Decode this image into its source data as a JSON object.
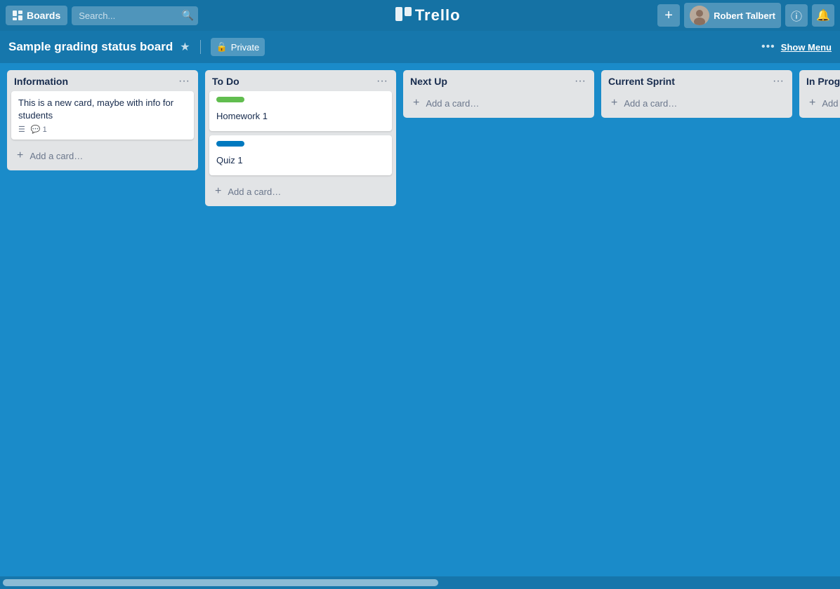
{
  "topNav": {
    "boards_label": "Boards",
    "search_placeholder": "Search...",
    "trello_label": "Trello",
    "add_button_label": "+",
    "user_name": "Robert Talbert",
    "info_icon": "ℹ",
    "notif_icon": "🔔"
  },
  "boardHeader": {
    "title": "Sample grading status board",
    "star_icon": "★",
    "privacy_icon": "🔒",
    "privacy_label": "Private",
    "show_menu_dots": "•••",
    "show_menu_label": "Show Menu"
  },
  "lists": [
    {
      "id": "information",
      "title": "Information",
      "menu_icon": "•••",
      "cards": [
        {
          "id": "card-info-1",
          "title": "This is a new card, maybe with info for students",
          "label": null,
          "has_description": true,
          "comment_count": "1"
        }
      ],
      "add_card_label": "Add a card…"
    },
    {
      "id": "to-do",
      "title": "To Do",
      "menu_icon": "•••",
      "cards": [
        {
          "id": "card-todo-1",
          "title": "Homework 1",
          "label": "green",
          "has_description": false,
          "comment_count": null
        },
        {
          "id": "card-todo-2",
          "title": "Quiz 1",
          "label": "blue",
          "has_description": false,
          "comment_count": null
        }
      ],
      "add_card_label": "Add a card…"
    },
    {
      "id": "next-up",
      "title": "Next Up",
      "menu_icon": "•••",
      "cards": [],
      "add_card_label": "Add a card…"
    },
    {
      "id": "current-sprint",
      "title": "Current Sprint",
      "menu_icon": "•••",
      "cards": [],
      "add_card_label": "Add a card…"
    },
    {
      "id": "in-progress",
      "title": "In Progress",
      "menu_icon": "•••",
      "cards": [],
      "add_card_label": "Add a card…"
    }
  ]
}
